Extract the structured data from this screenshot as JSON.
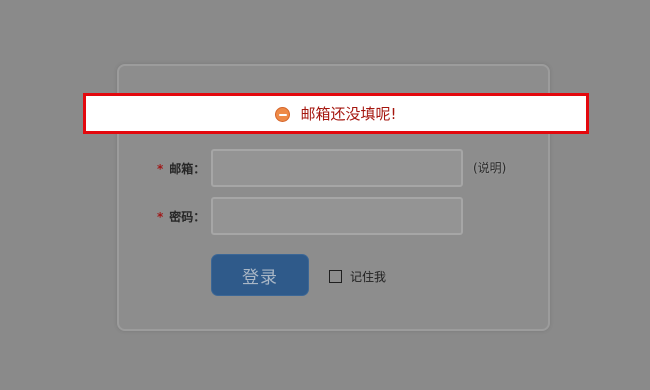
{
  "alert": {
    "icon": "minus-circle-icon",
    "message": "邮箱还没填呢!",
    "border_color": "#e3080d",
    "text_color": "#a5160e"
  },
  "form": {
    "required_mark": "*",
    "email": {
      "label": "邮箱：",
      "value": "",
      "help": "(说明)"
    },
    "password": {
      "label": "密码：",
      "value": ""
    }
  },
  "actions": {
    "login_label": "登录",
    "remember_label": "记住我",
    "remember_checked": false,
    "button_color": "#2f5a8a"
  }
}
